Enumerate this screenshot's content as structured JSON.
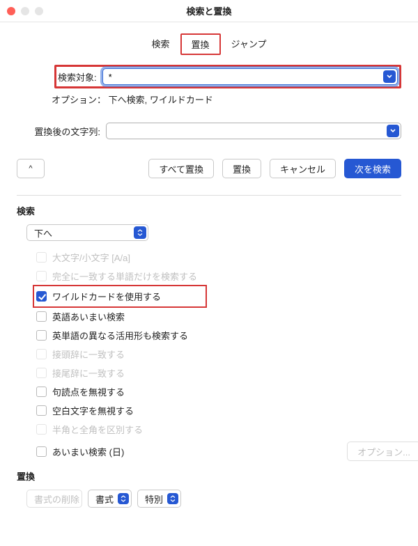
{
  "window": {
    "title": "検索と置換"
  },
  "tabs": {
    "search": "検索",
    "replace": "置換",
    "jump": "ジャンプ"
  },
  "search_row": {
    "label": "検索対象:",
    "value": "*"
  },
  "option_text": "オプション： 下へ検索, ワイルドカード",
  "replace_row": {
    "label": "置換後の文字列:",
    "value": ""
  },
  "buttons": {
    "chevron": "^",
    "replace_all": "すべて置換",
    "replace": "置換",
    "cancel": "キャンセル",
    "find_next": "次を検索"
  },
  "search_section": {
    "head": "検索",
    "direction_value": "下へ",
    "checks": {
      "match_case": "大文字/小文字 [A/a]",
      "whole_word": "完全に一致する単語だけを検索する",
      "wildcard": "ワイルドカードを使用する",
      "eng_fuzzy": "英語あいまい検索",
      "eng_inflect": "英単語の異なる活用形も検索する",
      "prefix": "接頭辞に一致する",
      "suffix": "接尾辞に一致する",
      "ignore_punct": "句読点を無視する",
      "ignore_space": "空白文字を無視する",
      "ignore_width": "半角と全角を区別する",
      "jp_fuzzy": "あいまい検索 (日)"
    },
    "options_button": "オプション..."
  },
  "replace_section": {
    "head": "置換",
    "delete_formatting": "書式の削除",
    "format": "書式",
    "special": "特別"
  }
}
